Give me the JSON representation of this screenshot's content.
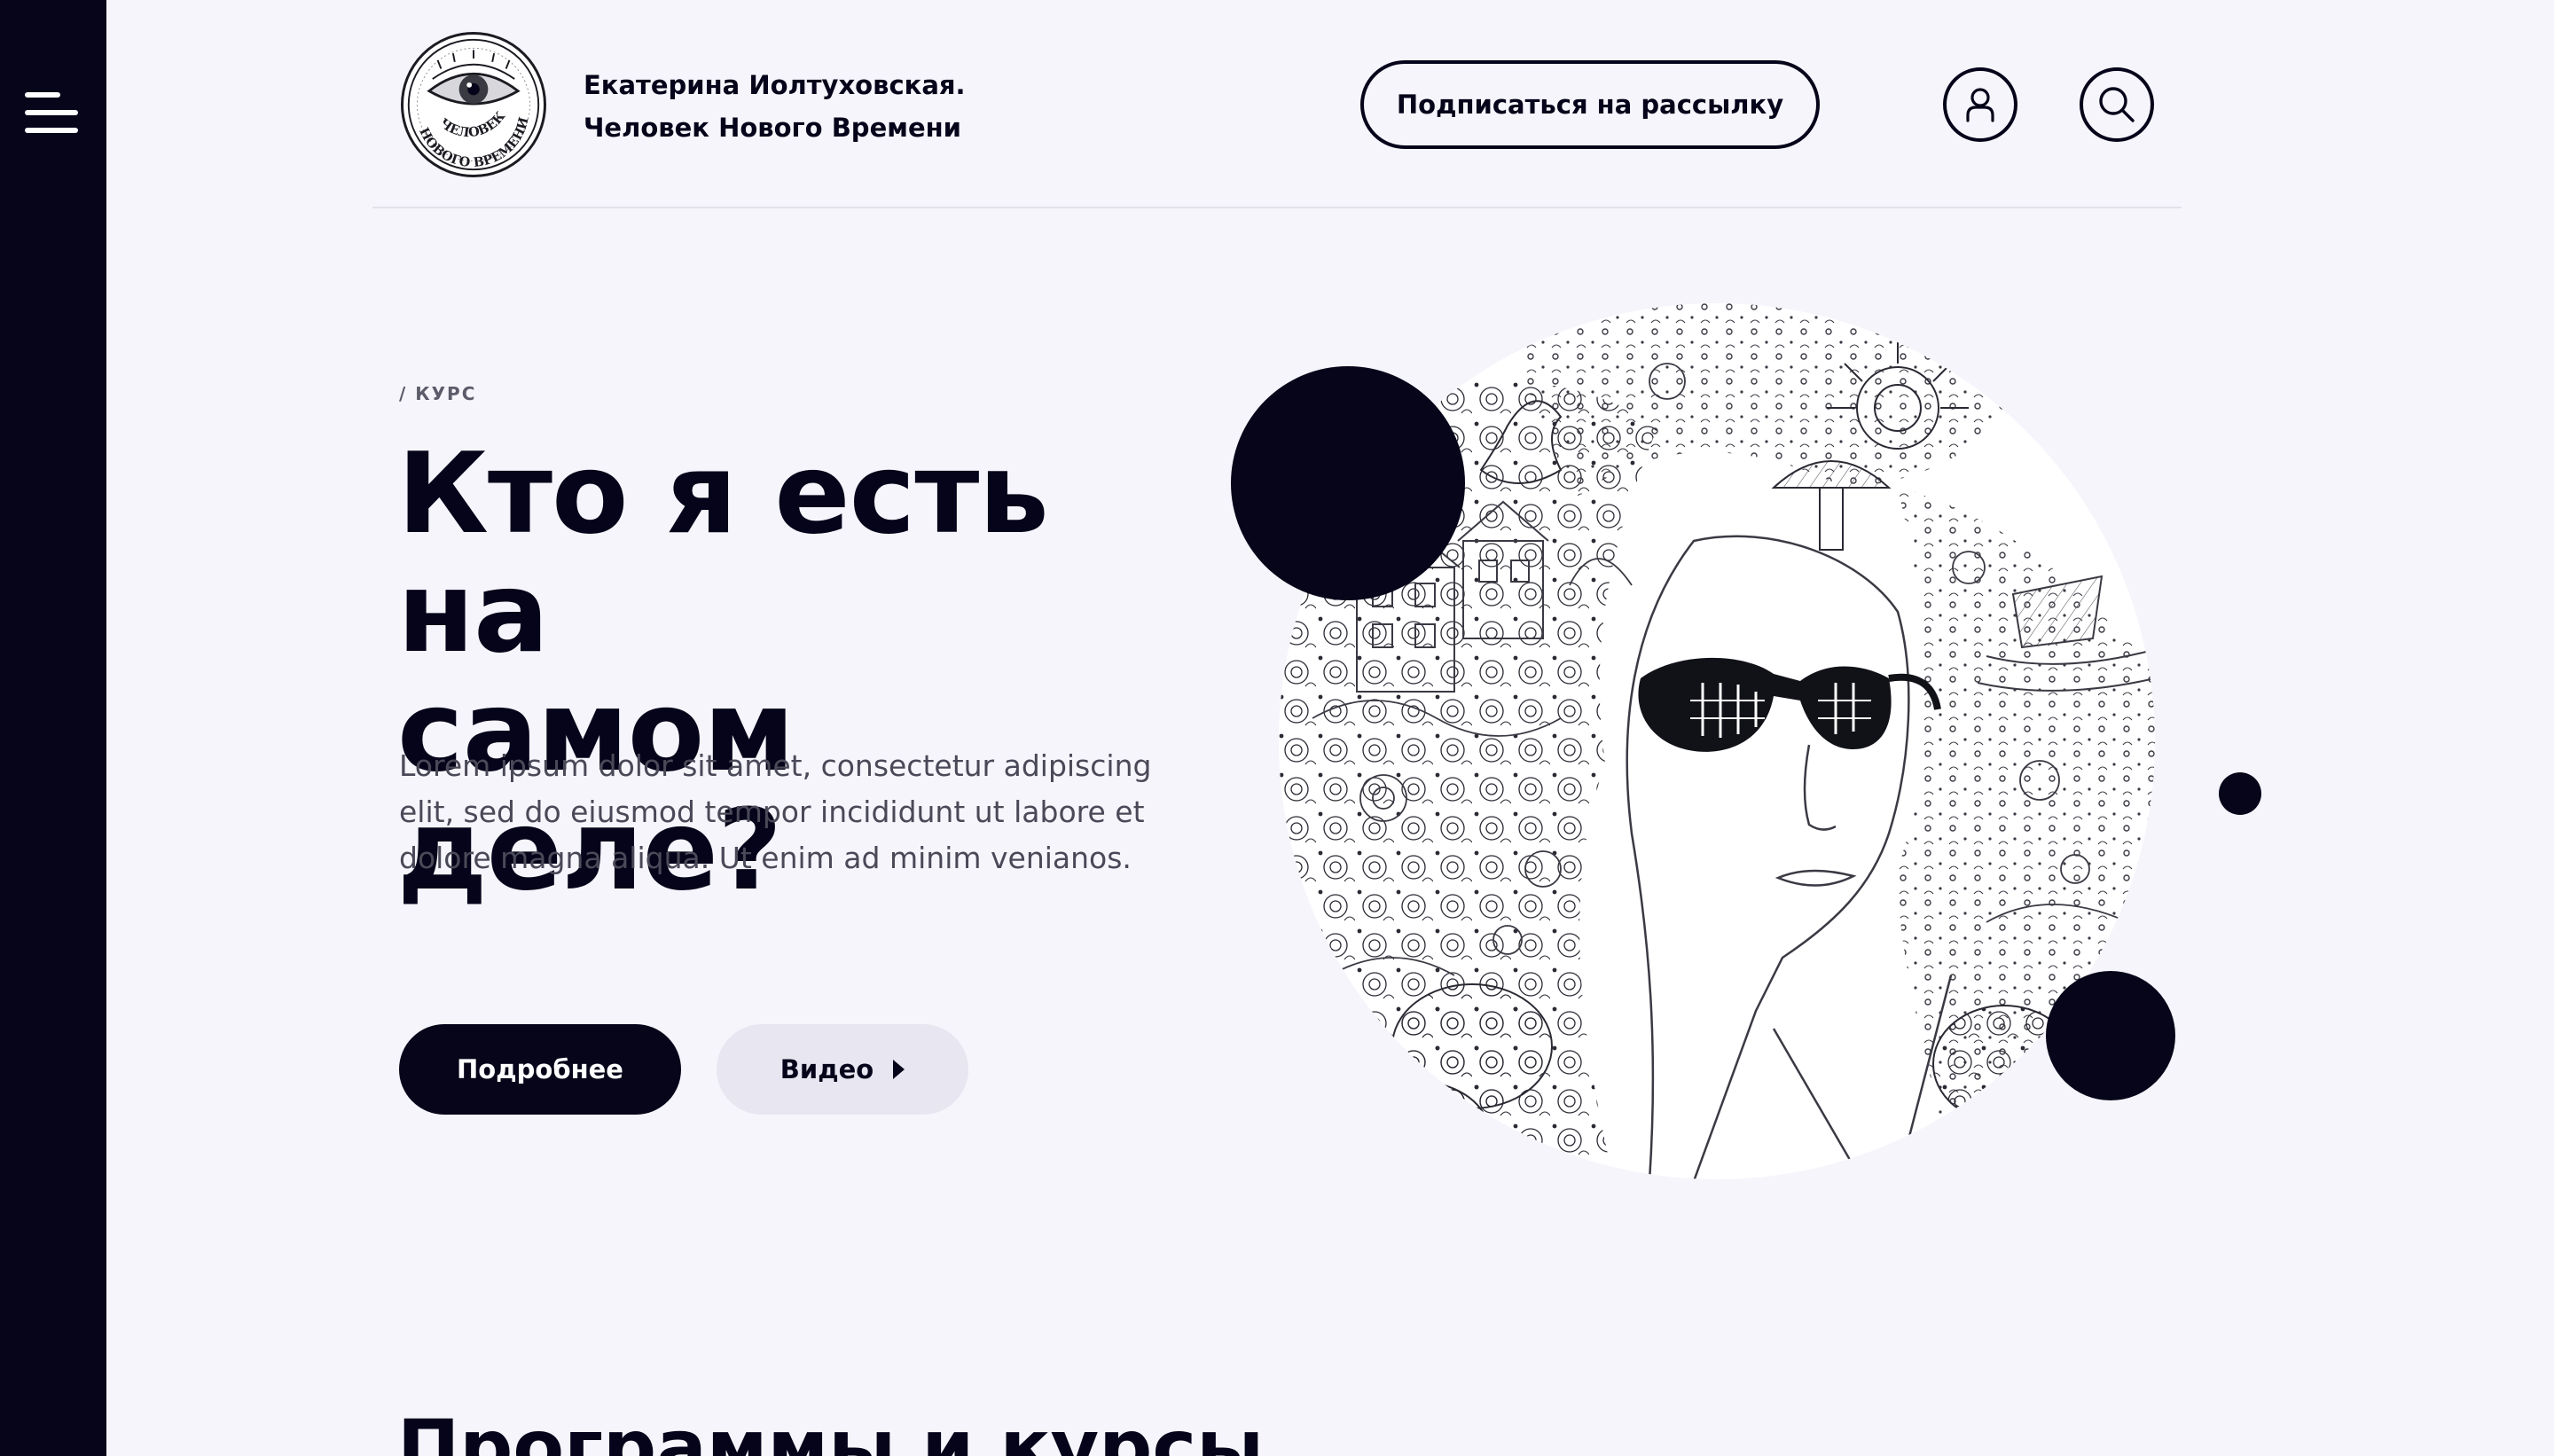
{
  "header": {
    "brand_line1": "Екатерина Иолтуховская.",
    "brand_line2": "Человек Нового Времени",
    "subscribe_label": "Подписаться на рассылку"
  },
  "hero": {
    "breadcrumb": "/ КУРС",
    "title_line1": "Кто я есть на",
    "title_line2": "самом деле?",
    "text_line1": "Lorem ipsum dolor sit amet, consectetur adipiscing",
    "text_line2": "elit, sed do eiusmod tempor incididunt ut labore et",
    "text_line3": "dolore magna aliqua. Ut enim ad minim venianos.",
    "more_label": "Подробнее",
    "video_label": "Видео"
  },
  "programs": {
    "title": "Программы и курсы"
  },
  "logo": {
    "line1": "ЧЕЛОВЕК",
    "line2": "НОВОГО ВРЕМЕНИ"
  },
  "icons": {
    "menu": "menu-icon",
    "user": "user-icon",
    "search": "search-icon",
    "play": "play-icon"
  },
  "colors": {
    "background": "#f6f5fb",
    "dark": "#06051a",
    "secondary_button": "#e8e6f0",
    "body_text": "#4a4958"
  }
}
